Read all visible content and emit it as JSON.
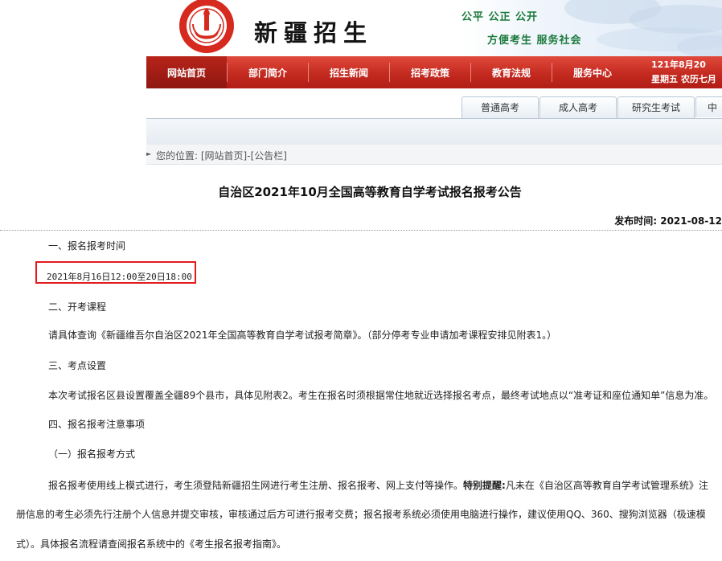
{
  "header": {
    "logo_text_top": "新疆招生",
    "site_title": "新疆招生",
    "slogan_line1": "公平 公正 公开",
    "slogan_line2": "方便考生 服务社会"
  },
  "nav": {
    "items": [
      "网站首页",
      "部门简介",
      "招生新闻",
      "招考政策",
      "教育法规",
      "服务中心"
    ],
    "active_index": 0,
    "date_line1": "121年8月20",
    "date_line2": "星期五 农历七月"
  },
  "category_tabs": [
    "普通高考",
    "成人高考",
    "研究生考试",
    "中"
  ],
  "breadcrumb": {
    "label": "您的位置:",
    "path": "[网站首页]-[公告栏]"
  },
  "article": {
    "title": "自治区2021年10月全国高等教育自学考试报名报考公告",
    "publish_label": "发布时间:",
    "publish_date": "2021-08-12",
    "s1_heading": "一、报名报考时间",
    "s1_time": "2021年8月16日12:00至20日18:00",
    "s2_heading": "二、开考课程",
    "s2_text": "请具体查询《新疆维吾尔自治区2021年全国高等教育自学考试报考简章》。（部分停考专业申请加考课程安排见附表1。）",
    "s3_heading": "三、考点设置",
    "s3_text": "本次考试报名区县设置覆盖全疆89个县市，具体见附表2。考生在报名时须根据常住地就近选择报名考点，最终考试地点以“准考证和座位通知单”信息为准。",
    "s4_heading": "四、报名报考注意事项",
    "s4_sub1": "（一）报名报考方式",
    "s4_p1_a": "报名报考使用线上模式进行，考生须登陆新疆招生网进行考生注册、报名报考、网上支付等操作。",
    "s4_p1_bold": "特别提醒:",
    "s4_p1_b": "凡未在《自治区高等教育自学考试管理系统》注",
    "s4_p1_line2": "册信息的考生必须先行注册个人信息并提交审核，审核通过后方可进行报考交费；报名报考系统必须使用电脑进行操作，建议使用QQ、360、搜狗浏览器（极速模",
    "s4_p1_line3": "式）。具体报名流程请查阅报名系统中的《考生报名报考指南》。"
  },
  "colors": {
    "nav_red": "#c42a20",
    "slogan_green": "#1b7a3c",
    "highlight_red": "#e31b1b"
  }
}
